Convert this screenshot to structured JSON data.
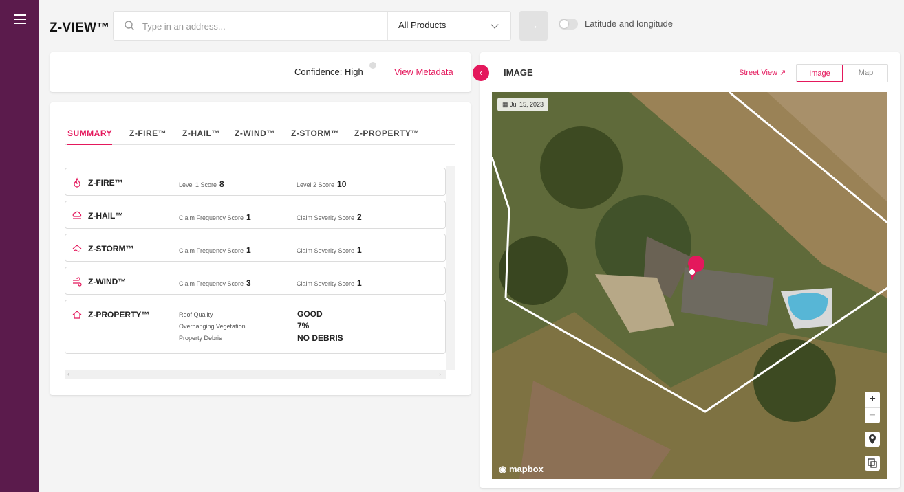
{
  "app": {
    "brand": "Z-VIEW™"
  },
  "search": {
    "placeholder": "Type in an address...",
    "product_select": "All Products"
  },
  "toggle": {
    "label": "Latitude and longitude"
  },
  "meta": {
    "confidence": "Confidence: High",
    "view_metadata": "View Metadata"
  },
  "tabs": [
    "SUMMARY",
    "Z-FIRE™",
    "Z-HAIL™",
    "Z-WIND™",
    "Z-STORM™",
    "Z-PROPERTY™"
  ],
  "scores": [
    {
      "name": "Z-FIRE™",
      "l1": "Level 1 Score",
      "v1": "8",
      "l2": "Level 2 Score",
      "v2": "10"
    },
    {
      "name": "Z-HAIL™",
      "l1": "Claim Frequency Score",
      "v1": "1",
      "l2": "Claim Severity Score",
      "v2": "2"
    },
    {
      "name": "Z-STORM™",
      "l1": "Claim Frequency Score",
      "v1": "1",
      "l2": "Claim Severity Score",
      "v2": "1"
    },
    {
      "name": "Z-WIND™",
      "l1": "Claim Frequency Score",
      "v1": "3",
      "l2": "Claim Severity Score",
      "v2": "1"
    }
  ],
  "property": {
    "name": "Z-PROPERTY™",
    "rows": [
      {
        "label": "Roof Quality",
        "value": "GOOD"
      },
      {
        "label": "Overhanging Vegetation",
        "value": "7%"
      },
      {
        "label": "Property Debris",
        "value": "NO DEBRIS"
      }
    ]
  },
  "imagery": {
    "title": "IMAGE",
    "street_view": "Street View",
    "seg_image": "Image",
    "seg_map": "Map",
    "date": "Jul 15, 2023",
    "attribution": "mapbox",
    "zoom_in": "+",
    "zoom_out": "−"
  },
  "colors": {
    "accent": "#e4185c",
    "sidebar": "#5b1b4c"
  }
}
